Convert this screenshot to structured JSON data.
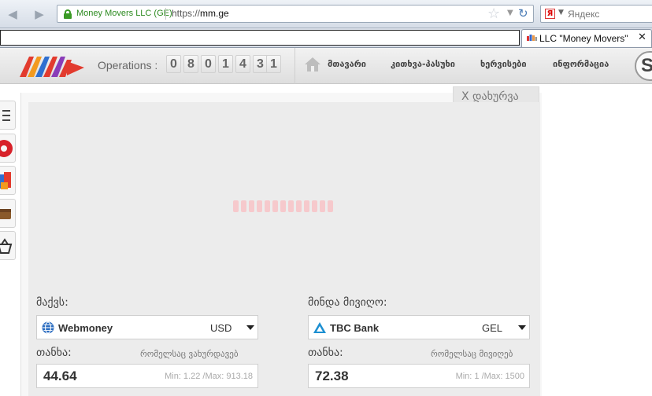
{
  "browser": {
    "site_identity": "Money Movers LLC (GE)",
    "url_prefix": "https://",
    "url_host": "mm.ge",
    "search_placeholder": "Яндекс",
    "search_logo": "Я",
    "tab_title": "LLC \"Money Movers\""
  },
  "header": {
    "operations_label": "Operations :",
    "counter": [
      "0",
      "8",
      "0",
      "1",
      "4",
      "3",
      "1"
    ],
    "nav": [
      "მთავარი",
      "კითხვა-პასუხი",
      "ხერვისები",
      "ინფორმაცია"
    ],
    "skype_letter": "S"
  },
  "panel": {
    "close_label": "X დახურვა",
    "loader_bars": 13,
    "give": {
      "label": "მაქვს:",
      "system": "Webmoney",
      "currency": "USD",
      "amount_label": "თანხა:",
      "amount_hint": "რომელსაც ვახურდავებ",
      "amount": "44.64",
      "range": "Min: 1.22 /Max: 913.18"
    },
    "receive": {
      "label": "მინდა მივიღო:",
      "system": "TBC Bank",
      "currency": "GEL",
      "amount_label": "თანხა:",
      "amount_hint": "რომელსაც მივიღებ",
      "amount": "72.38",
      "range": "Min: 1 /Max: 1500"
    }
  },
  "colors": {
    "loader": "#f6c9cc",
    "secure_green": "#3a9a25",
    "webmoney_blue": "#2a6cc0",
    "tbc_blue": "#1c8fd1"
  }
}
